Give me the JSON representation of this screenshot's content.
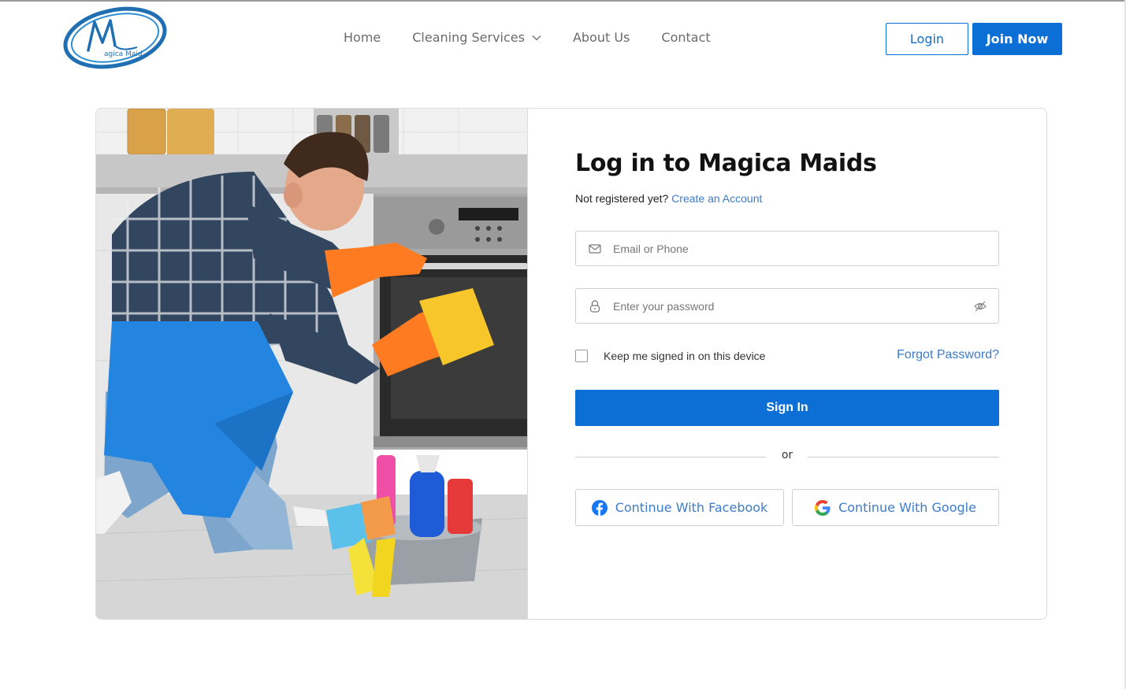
{
  "logo": {
    "wordmark": "agica Maid",
    "initial": "M"
  },
  "nav": {
    "home": "Home",
    "services": "Cleaning Services",
    "about": "About Us",
    "contact": "Contact"
  },
  "header_buttons": {
    "login": "Login",
    "join": "Join Now"
  },
  "form": {
    "title": "Log in to Magica Maids",
    "not_registered": "Not registered yet?",
    "create_account": "Create an Account",
    "email_placeholder": "Email or Phone",
    "password_placeholder": "Enter your password",
    "remember_label": "Keep me signed in on this device",
    "forgot": "Forgot Password?",
    "signin": "Sign In",
    "or": "or",
    "facebook": "Continue With Facebook",
    "google": "Continue With Google"
  },
  "colors": {
    "accent": "#0b6fd6",
    "link": "#3d7cc9",
    "facebook": "#1877f2"
  }
}
